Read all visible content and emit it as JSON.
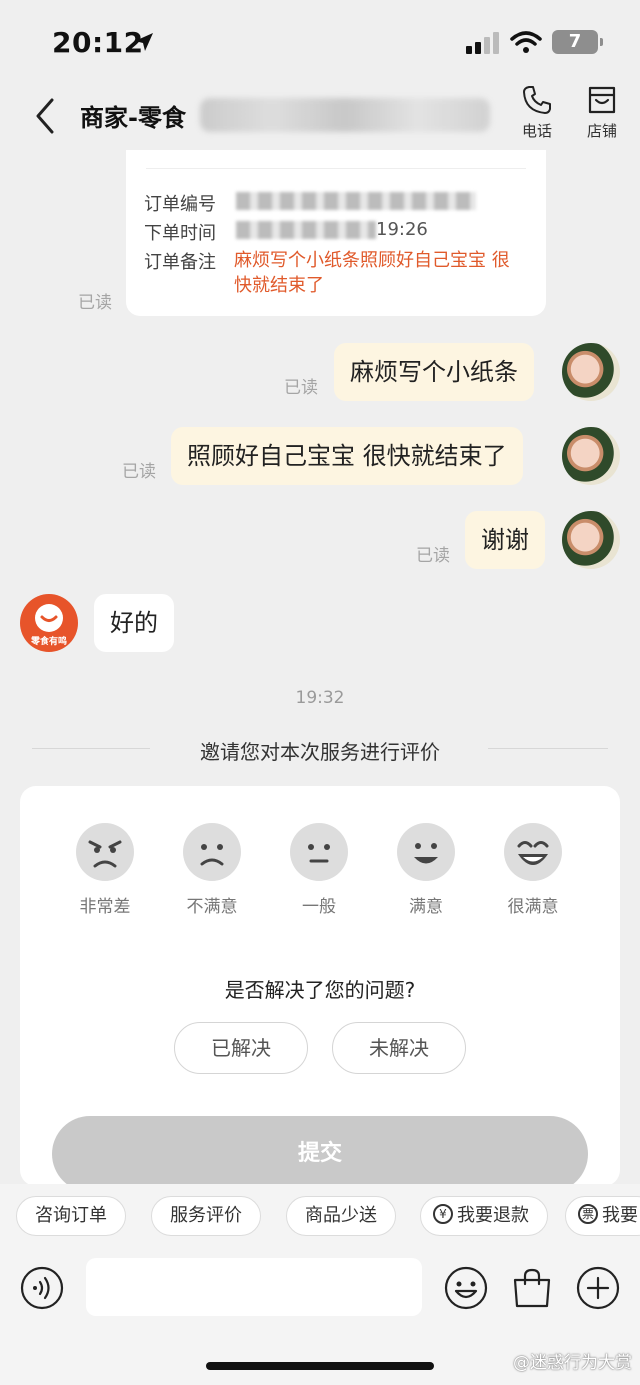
{
  "status_bar": {
    "time": "20:12",
    "battery": "7"
  },
  "header": {
    "title": "商家-零食",
    "phone_label": "电话",
    "shop_label": "店铺"
  },
  "order": {
    "number_label": "订单编号",
    "time_label": "下单时间",
    "time_value_visible": "19:26",
    "note_label": "订单备注",
    "note_value": "麻烦写个小纸条照顾好自己宝宝 很快就结束了",
    "read": "已读"
  },
  "messages": [
    {
      "text": "麻烦写个小纸条",
      "read": "已读",
      "side": "right"
    },
    {
      "text": "照顾好自己宝宝 很快就结束了",
      "read": "已读",
      "side": "right"
    },
    {
      "text": "谢谢",
      "read": "已读",
      "side": "right"
    },
    {
      "text": "好的",
      "side": "left"
    }
  ],
  "shop_avatar_text": "零食有鸣",
  "timestamp": "19:32",
  "invite_text": "邀请您对本次服务进行评价",
  "rating": {
    "options": [
      "非常差",
      "不满意",
      "一般",
      "满意",
      "很满意"
    ],
    "question": "是否解决了您的问题?",
    "choices": [
      "已解决",
      "未解决"
    ],
    "submit": "提交"
  },
  "quick_actions": [
    "咨询订单",
    "服务评价",
    "商品少送",
    "我要退款",
    "我要"
  ],
  "watermark": "@迷惑行为大赏",
  "colors": {
    "accent_orange": "#e05a2b",
    "bubble_right": "#fdf5e1",
    "submit_disabled": "#c9c9c9"
  }
}
